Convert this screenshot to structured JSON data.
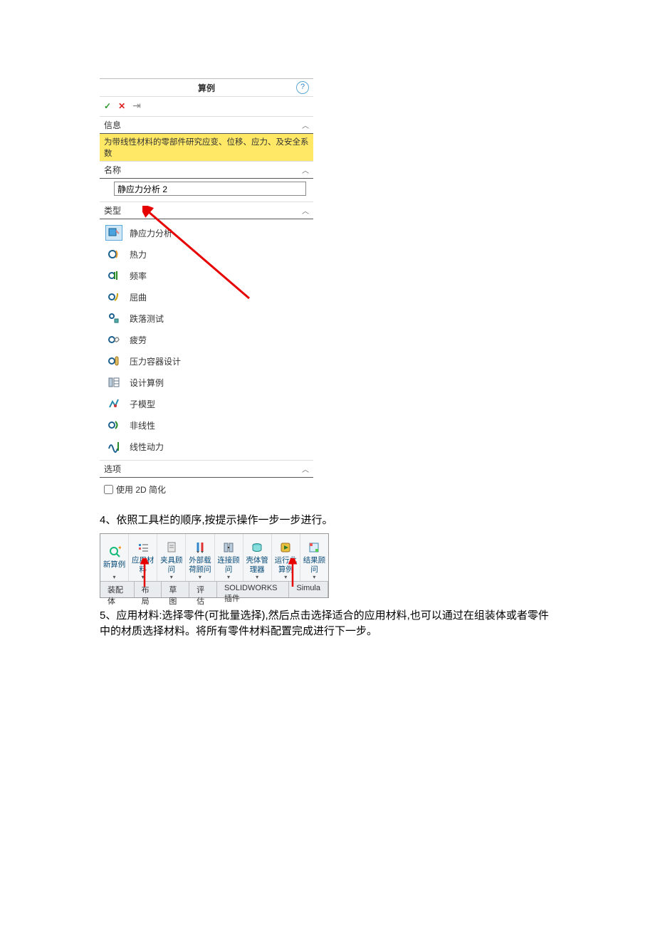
{
  "panel": {
    "title": "算例",
    "help_symbol": "?",
    "actions": {
      "ok": "✓",
      "cancel": "✕",
      "pin": "⇥"
    },
    "sections": {
      "info": {
        "header": "信息",
        "banner": "为带线性材料的零部件研究应变、位移、应力、及安全系数"
      },
      "name": {
        "header": "名称",
        "value": "静应力分析 2"
      },
      "type": {
        "header": "类型",
        "items": [
          {
            "label": "静应力分析",
            "selected": true
          },
          {
            "label": "热力"
          },
          {
            "label": "频率"
          },
          {
            "label": "屈曲"
          },
          {
            "label": "跌落测试"
          },
          {
            "label": "疲劳"
          },
          {
            "label": "压力容器设计"
          },
          {
            "label": "设计算例"
          },
          {
            "label": "子模型"
          },
          {
            "label": "非线性"
          },
          {
            "label": "线性动力"
          }
        ]
      },
      "options": {
        "header": "选项",
        "checkbox_label": "使用 2D 简化"
      }
    }
  },
  "instructions": {
    "step4": "4、依照工具栏的顺序,按提示操作一步一步进行。",
    "step5": "5、应用材料:选择零件(可批量选择),然后点击选择适合的应用材料,也可以通过在组装体或者零件中的材质选择材料。将所有零件材料配置完成进行下一步。"
  },
  "toolbar": {
    "buttons": [
      {
        "label": "新算例"
      },
      {
        "label": "应用材料"
      },
      {
        "label": "夹具顾问"
      },
      {
        "label": "外部载荷顾问"
      },
      {
        "label": "连接顾问"
      },
      {
        "label": "壳体管理器"
      },
      {
        "label": "运行此算例"
      },
      {
        "label": "结果顾问"
      }
    ],
    "tabs": [
      "装配体",
      "布局",
      "草图",
      "评估",
      "SOLIDWORKS 插件",
      "Simula"
    ]
  }
}
